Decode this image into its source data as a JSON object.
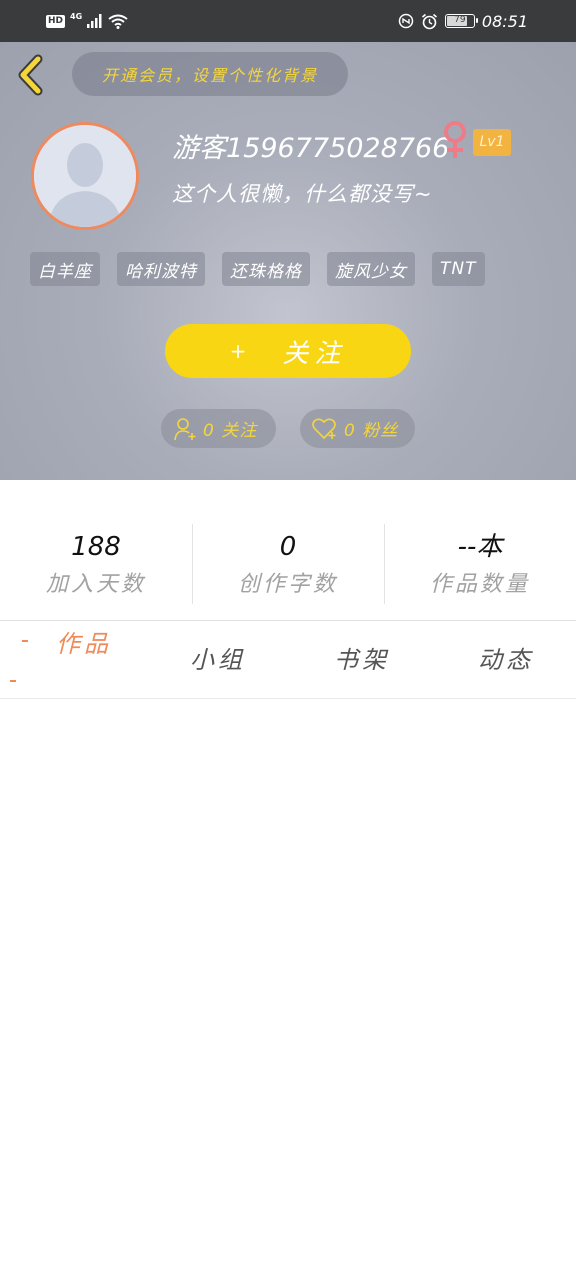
{
  "status_bar": {
    "hd": "HD",
    "network": "4G",
    "battery": "79",
    "battery_level": 0.79,
    "time": "08:51",
    "icons": [
      "signal-icon",
      "wifi-icon",
      "nfc-icon",
      "alarm-icon"
    ]
  },
  "header": {
    "vip_text": "开通会员，设置个性化背景",
    "username": "游客15967750287​66",
    "level": "Lv1",
    "bio": "这个人很懒，什么都没写~",
    "tags": [
      "白羊座",
      "哈利波特",
      "还珠格格",
      "旋风少女",
      "TNT"
    ],
    "follow_plus": "+",
    "follow_label": "关注",
    "following_text": "0 关注",
    "fans_text": "0 粉丝"
  },
  "stats": [
    {
      "value": "188",
      "label": "加入天数"
    },
    {
      "value": "0",
      "label": "创作字数"
    },
    {
      "value": "--本",
      "label": "作品数量"
    }
  ],
  "tabs": [
    "作品",
    "小组",
    "书架",
    "动态"
  ],
  "colors": {
    "accent_yellow": "#f8d613",
    "accent_orange": "#ef8b58",
    "gold_text": "#f5d63a",
    "status_bar": "#3a3b3d"
  }
}
